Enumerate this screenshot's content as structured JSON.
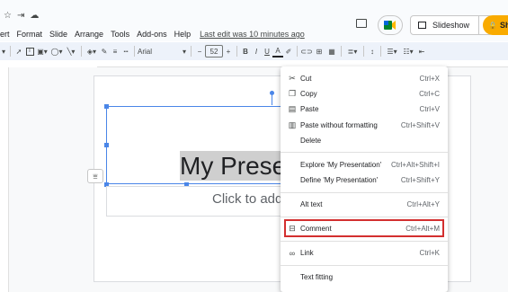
{
  "menubar": {
    "items": [
      "ert",
      "Format",
      "Slide",
      "Arrange",
      "Tools",
      "Add-ons",
      "Help"
    ],
    "last_edit": "Last edit was 10 minutes ago"
  },
  "header": {
    "slideshow_label": "Slideshow",
    "share_label": "Sh"
  },
  "toolbar": {
    "font": "Arial",
    "font_size": "52"
  },
  "slide": {
    "title": "My Prese",
    "subtitle": "Click to add"
  },
  "context_menu": {
    "items": [
      {
        "label": "Cut",
        "shortcut": "Ctrl+X",
        "icon": "scissors-icon"
      },
      {
        "label": "Copy",
        "shortcut": "Ctrl+C",
        "icon": "copy-icon"
      },
      {
        "label": "Paste",
        "shortcut": "Ctrl+V",
        "icon": "paste-icon"
      },
      {
        "label": "Paste without formatting",
        "shortcut": "Ctrl+Shift+V",
        "icon": "paste-plain-icon"
      },
      {
        "label": "Delete",
        "shortcut": "",
        "icon": ""
      },
      {
        "label": "Explore 'My Presentation'",
        "shortcut": "Ctrl+Alt+Shift+I",
        "icon": ""
      },
      {
        "label": "Define 'My Presentation'",
        "shortcut": "Ctrl+Shift+Y",
        "icon": ""
      },
      {
        "label": "Alt text",
        "shortcut": "Ctrl+Alt+Y",
        "icon": ""
      },
      {
        "label": "Comment",
        "shortcut": "Ctrl+Alt+M",
        "icon": "comment-icon"
      },
      {
        "label": "Link",
        "shortcut": "Ctrl+K",
        "icon": "link-icon"
      },
      {
        "label": "Text fitting",
        "shortcut": "",
        "icon": ""
      }
    ]
  },
  "colors": {
    "accent": "#4a86e8",
    "highlight_box": "#d32f2f",
    "share": "#f9ab00"
  }
}
